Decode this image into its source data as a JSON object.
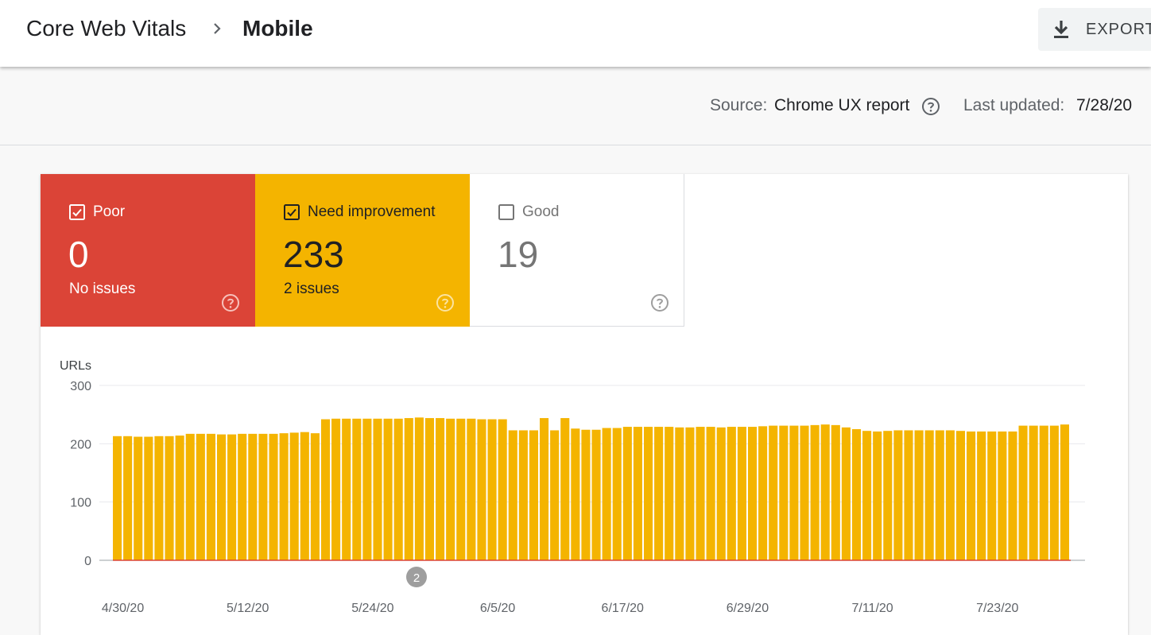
{
  "header": {
    "breadcrumb_root": "Core Web Vitals",
    "breadcrumb_current": "Mobile",
    "export_label": "EXPORT"
  },
  "meta": {
    "source_prefix": "Source:",
    "source_value": "Chrome UX report",
    "updated_prefix": "Last updated:",
    "updated_value": "7/28/20"
  },
  "tiles": [
    {
      "label": "Poor",
      "count": "0",
      "sub": "No issues",
      "checked": true,
      "color": "#db4437"
    },
    {
      "label": "Need improvement",
      "count": "233",
      "sub": "2 issues",
      "checked": true,
      "color": "#f4b400"
    },
    {
      "label": "Good",
      "count": "19",
      "sub": "",
      "checked": false,
      "color": "#ffffff"
    }
  ],
  "icons": {
    "breadcrumb_separator": "chevron-right-icon",
    "export": "download-icon",
    "help": "help-circle-icon",
    "checkbox_on": "checkbox-checked-icon",
    "checkbox_off": "checkbox-empty-icon"
  },
  "chart_data": {
    "type": "bar",
    "ylabel": "URLs",
    "ylim": [
      0,
      300
    ],
    "yticks": [
      0,
      100,
      200,
      300
    ],
    "xticks": [
      "4/30/20",
      "5/12/20",
      "5/24/20",
      "6/5/20",
      "6/17/20",
      "6/29/20",
      "7/11/20",
      "7/23/20"
    ],
    "grid": true,
    "annotation": {
      "label": "2",
      "date": "5/27/20"
    },
    "series": [
      {
        "name": "Need improvement",
        "color": "#f4b400",
        "values": [
          213,
          213,
          212,
          212,
          213,
          213,
          214,
          217,
          217,
          217,
          216,
          216,
          217,
          217,
          217,
          217,
          218,
          219,
          220,
          218,
          242,
          243,
          243,
          243,
          243,
          243,
          243,
          243,
          244,
          245,
          244,
          244,
          243,
          243,
          243,
          242,
          242,
          242,
          223,
          223,
          223,
          244,
          223,
          244,
          226,
          224,
          224,
          227,
          227,
          229,
          229,
          229,
          229,
          229,
          228,
          228,
          229,
          229,
          228,
          229,
          229,
          229,
          230,
          231,
          231,
          231,
          231,
          232,
          233,
          232,
          228,
          225,
          222,
          221,
          222,
          223,
          223,
          223,
          223,
          223,
          223,
          222,
          221,
          221,
          221,
          221,
          221,
          231,
          231,
          231,
          231,
          233
        ]
      },
      {
        "name": "Poor",
        "color": "#db4437",
        "values": [
          0,
          0,
          0,
          0,
          0,
          0,
          0,
          0,
          0,
          0,
          0,
          0,
          0,
          0,
          0,
          0,
          0,
          0,
          0,
          0,
          0,
          0,
          0,
          0,
          0,
          0,
          0,
          0,
          0,
          0,
          0,
          0,
          0,
          0,
          0,
          0,
          0,
          0,
          0,
          0,
          0,
          0,
          0,
          0,
          0,
          0,
          0,
          0,
          0,
          0,
          0,
          0,
          0,
          0,
          0,
          0,
          0,
          0,
          0,
          0,
          0,
          0,
          0,
          0,
          0,
          0,
          0,
          0,
          0,
          0,
          0,
          0,
          0,
          0,
          0,
          0,
          0,
          0,
          0,
          0,
          0,
          0,
          0,
          0,
          0,
          0,
          0,
          0,
          0,
          0,
          0,
          0
        ]
      }
    ]
  }
}
